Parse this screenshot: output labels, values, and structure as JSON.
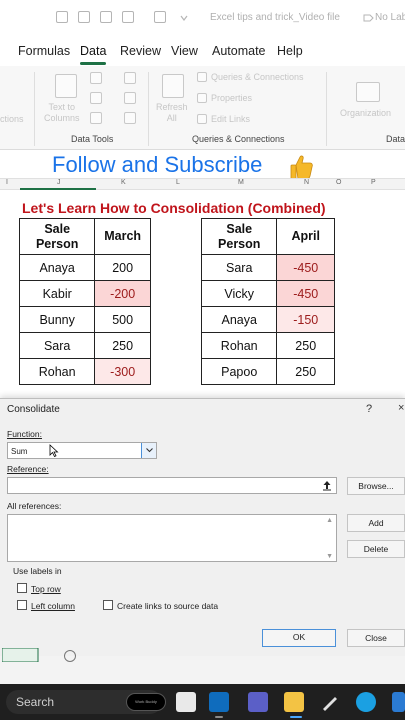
{
  "window": {
    "title": "Excel tips and trick_Video file",
    "label": "No Label"
  },
  "ribbon": {
    "tabs": [
      {
        "label": "Formulas"
      },
      {
        "label": "Data"
      },
      {
        "label": "Review"
      },
      {
        "label": "View"
      },
      {
        "label": "Automate"
      },
      {
        "label": "Help"
      }
    ],
    "active_tab": "Data",
    "faint_items": {
      "text_to_columns": "Text to\nColumns",
      "refresh_all": "Refresh\nAll",
      "queries_connections": "Queries & Connections",
      "properties": "Properties",
      "edit_links": "Edit Links",
      "organization": "Organization",
      "left_cut": "ctions"
    },
    "groups": {
      "data_tools": "Data Tools",
      "queries_connections": "Queries & Connections",
      "data_cut": "Data"
    }
  },
  "sheet": {
    "banner": "Follow and Subscribe",
    "column_letters": [
      "I",
      "J",
      "K",
      "L",
      "M",
      "N",
      "O",
      "P"
    ],
    "title": "Let's Learn How to Consolidation (Combined)",
    "table_march": {
      "headers": [
        "Sale\nPerson",
        "March"
      ],
      "rows": [
        {
          "name": "Anaya",
          "value": "200",
          "neg": false
        },
        {
          "name": "Kabir",
          "value": "-200",
          "neg": true
        },
        {
          "name": "Bunny",
          "value": "500",
          "neg": false
        },
        {
          "name": "Sara",
          "value": "250",
          "neg": false
        },
        {
          "name": "Rohan",
          "value": "-300",
          "neg": true
        }
      ]
    },
    "table_april": {
      "headers": [
        "Sale\nPerson",
        "April"
      ],
      "rows": [
        {
          "name": "Sara",
          "value": "-450",
          "neg": true
        },
        {
          "name": "Vicky",
          "value": "-450",
          "neg": true
        },
        {
          "name": "Anaya",
          "value": "-150",
          "neg": true
        },
        {
          "name": "Rohan",
          "value": "250",
          "neg": false
        },
        {
          "name": "Papoo",
          "value": "250",
          "neg": false
        }
      ]
    }
  },
  "dialog": {
    "title": "Consolidate",
    "help": "?",
    "close": "×",
    "function_label": "Function:",
    "function_value": "Sum",
    "reference_label": "Reference:",
    "reference_value": "",
    "browse_label": "Browse...",
    "all_references_label": "All references:",
    "add_label": "Add",
    "delete_label": "Delete",
    "use_labels_in": "Use labels in",
    "top_row": "Top row",
    "left_column": "Left column",
    "create_links": "Create links to source data",
    "ok_label": "OK",
    "close_label": "Close"
  },
  "taskbar": {
    "search_placeholder": "Search",
    "search_pill": "Work Buddy",
    "apps": [
      {
        "icon": "file-explorer-icon",
        "color": "#f3c344"
      },
      {
        "icon": "outlook-icon",
        "color": "#0f6cbd"
      },
      {
        "icon": "teams-icon",
        "color": "#5b5fc7"
      },
      {
        "icon": "folder-icon",
        "color": "#f3c344"
      },
      {
        "icon": "edge-icon",
        "color": "#1ba0e2"
      }
    ]
  }
}
